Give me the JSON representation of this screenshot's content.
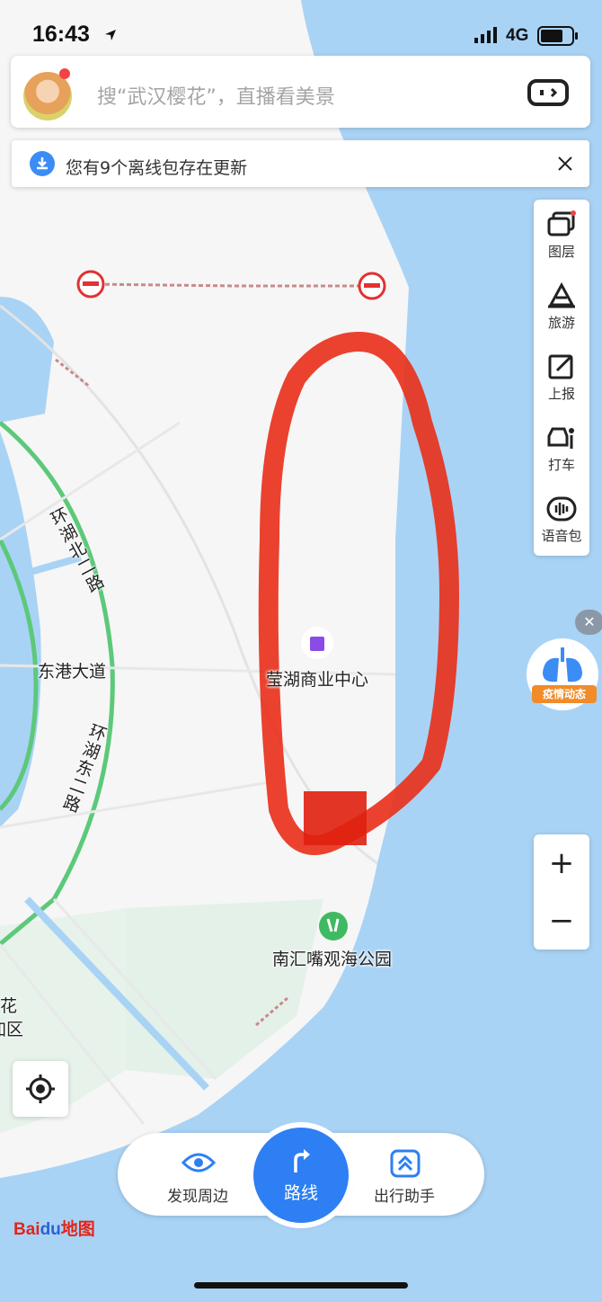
{
  "status_bar": {
    "time": "16:43",
    "network": "4G"
  },
  "search": {
    "placeholder": "搜“武汉樱花”，直播看美景"
  },
  "notice": {
    "text": "您有9个离线包存在更新"
  },
  "toolbar": {
    "items": [
      {
        "label": "图层",
        "icon": "layers-icon"
      },
      {
        "label": "旅游",
        "icon": "travel-icon"
      },
      {
        "label": "上报",
        "icon": "report-icon"
      },
      {
        "label": "打车",
        "icon": "taxi-icon"
      },
      {
        "label": "语音包",
        "icon": "voice-pack-icon"
      }
    ]
  },
  "map_labels": {
    "road_north": "环湖北二路",
    "road_east": "环湖东二路",
    "avenue": "东港大道",
    "poi_commercial": "莹湖商业中心",
    "poi_park": "南汇嘴观海公园",
    "edge_1": "花",
    "edge_2": "加区"
  },
  "epidemic": {
    "tag": "疫情动态"
  },
  "zoom": {
    "in": "+",
    "out": "−"
  },
  "bottom_bar": {
    "discover": "发现周边",
    "route": "路线",
    "assistant": "出行助手"
  },
  "brand": {
    "bai": "Bai",
    "du": "du",
    "map": "地图"
  },
  "colors": {
    "accent": "#2d7ff3",
    "water": "#a9d3f5",
    "land": "#f5f5f5",
    "ring_road": "#5cc97a",
    "annotation": "#e8321c"
  }
}
